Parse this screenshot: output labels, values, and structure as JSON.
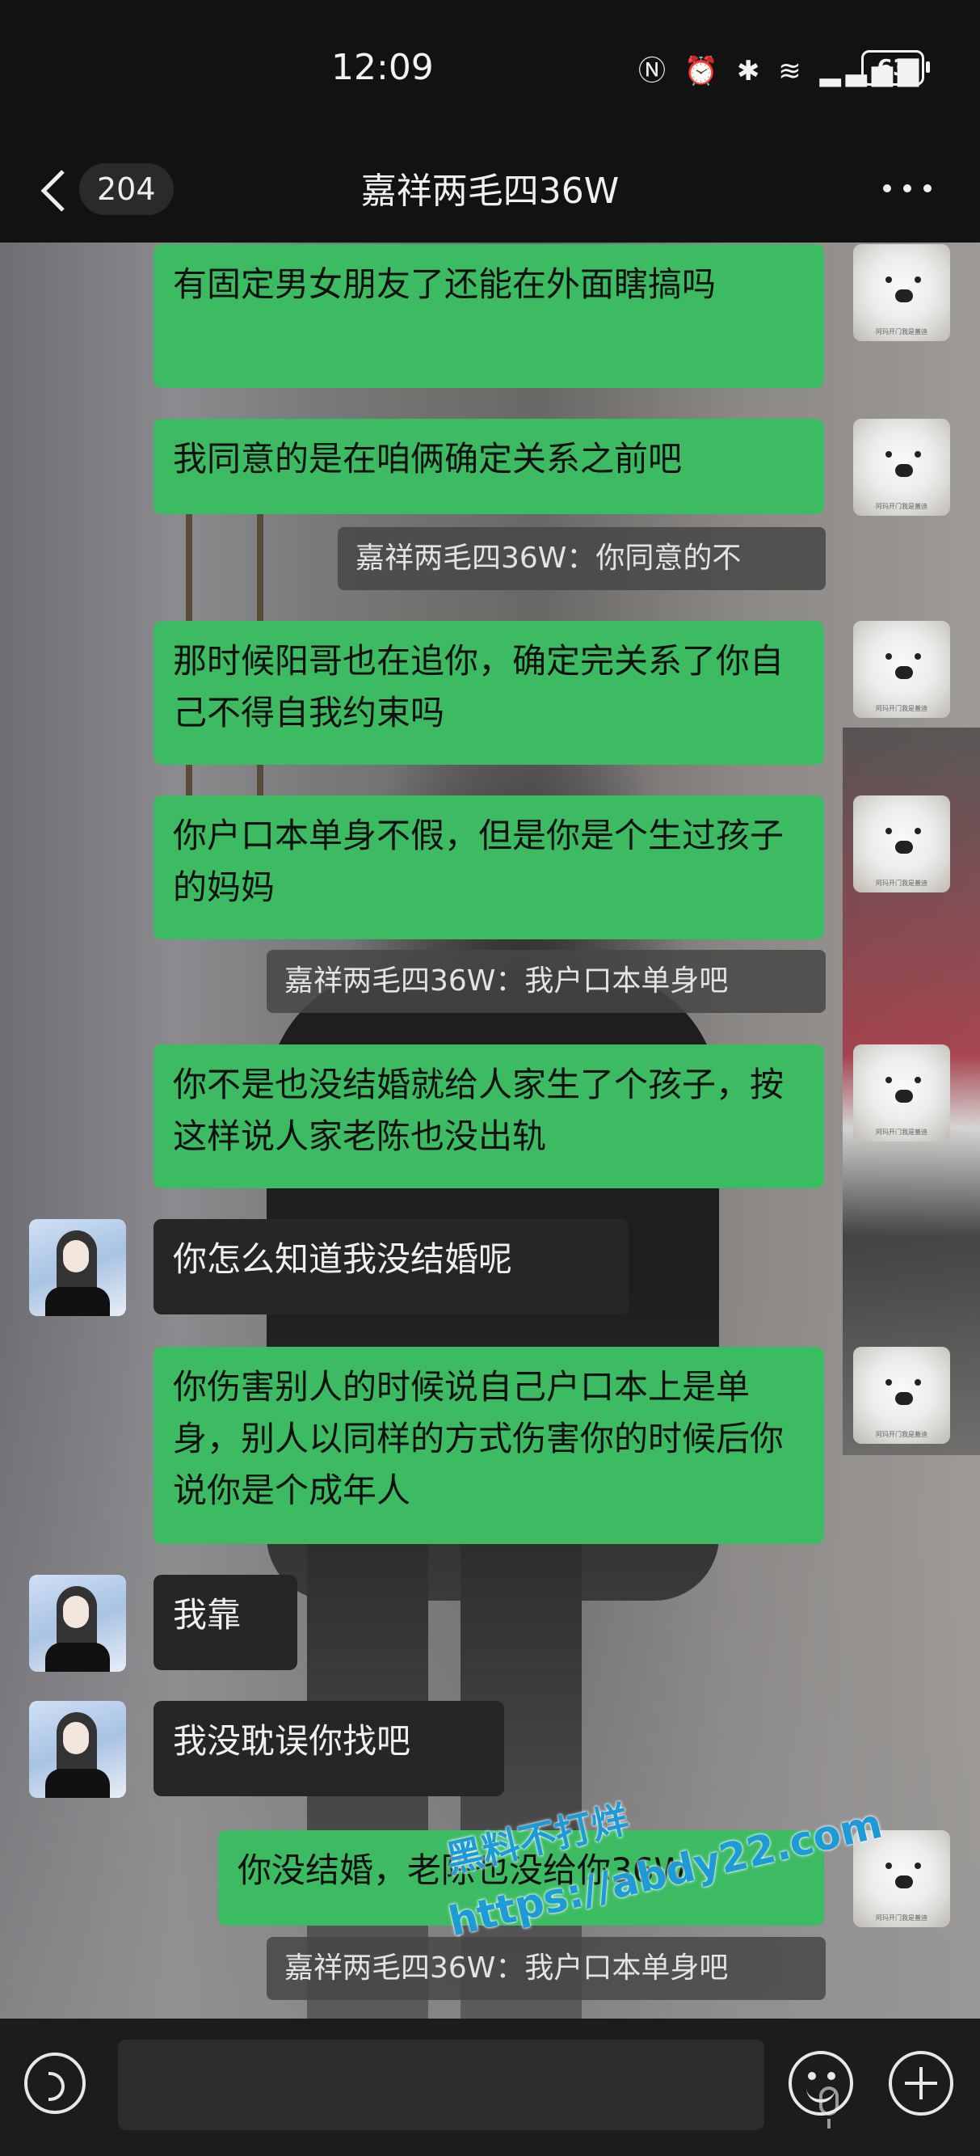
{
  "status_bar": {
    "time": "12:09",
    "battery": "63",
    "icons": [
      "nfc-icon",
      "alarm-icon",
      "bluetooth-icon",
      "wifi-icon",
      "5g-signal-icon"
    ]
  },
  "header": {
    "back_count": "204",
    "title": "嘉祥两毛四36W",
    "more_icon": "more-icon"
  },
  "messages": [
    {
      "side": "out",
      "text": "有固定男女朋友了还能在外面瞎搞吗"
    },
    {
      "side": "out",
      "text": "我同意的是在咱俩确定关系之前吧"
    },
    {
      "side": "quote",
      "text": "嘉祥两毛四36W：你同意的不"
    },
    {
      "side": "out",
      "text": "那时候阳哥也在追你，确定完关系了你自己不得自我约束吗"
    },
    {
      "side": "out",
      "text": "你户口本单身不假，但是你是个生过孩子的妈妈"
    },
    {
      "side": "quote",
      "text": "嘉祥两毛四36W：我户口本单身吧"
    },
    {
      "side": "out",
      "text": "你不是也没结婚就给人家生了个孩子，按这样说人家老陈也没出轨"
    },
    {
      "side": "in",
      "text": "你怎么知道我没结婚呢"
    },
    {
      "side": "out",
      "text": "你伤害别人的时候说自己户口本上是单身，别人以同样的方式伤害你的时候后你说你是个成年人"
    },
    {
      "side": "in",
      "text": "我靠"
    },
    {
      "side": "in",
      "text": "我没耽误你找吧"
    },
    {
      "side": "out",
      "text": "你没结婚，老陈也没给你36W"
    },
    {
      "side": "quote",
      "text": "嘉祥两毛四36W：我户口本单身吧"
    }
  ],
  "watermark": {
    "line1": "黑料不打烊",
    "line2": "https://abdy22.com"
  },
  "input_bar": {
    "placeholder": "",
    "icons": [
      "voice-icon",
      "mic-icon",
      "emoji-icon",
      "plus-icon"
    ]
  },
  "colors": {
    "outgoing_bubble": "#3dbb63",
    "incoming_bubble": "#262626",
    "bar_background": "#121212",
    "watermark": "#1e9bd7"
  }
}
